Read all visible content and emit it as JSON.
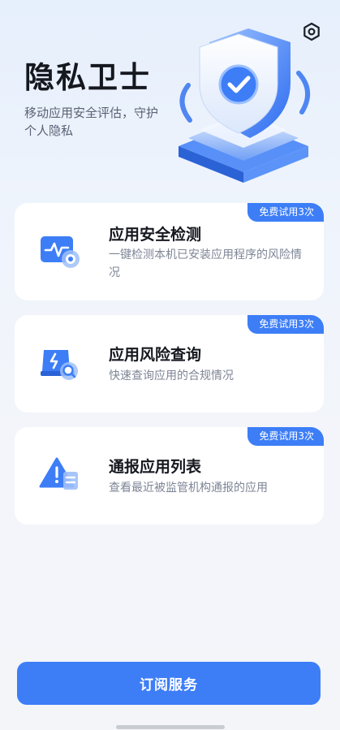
{
  "header": {
    "settings_icon": "gear-icon"
  },
  "hero": {
    "title": "隐私卫士",
    "subtitle": "移动应用安全评估，守护个人隐私",
    "illustration": "shield-check-icon"
  },
  "cards": [
    {
      "badge": "免费试用3次",
      "title": "应用安全检测",
      "desc": "一键检测本机已安装应用程序的风险情况",
      "icon": "app-scan-icon"
    },
    {
      "badge": "免费试用3次",
      "title": "应用风险查询",
      "desc": "快速查询应用的合规情况",
      "icon": "risk-search-icon"
    },
    {
      "badge": "免费试用3次",
      "title": "通报应用列表",
      "desc": "查看最近被监管机构通报的应用",
      "icon": "warning-list-icon"
    }
  ],
  "footer": {
    "subscribe_label": "订阅服务"
  },
  "colors": {
    "accent": "#3d7ef7",
    "background": "#f3f5f9",
    "card": "#ffffff"
  }
}
